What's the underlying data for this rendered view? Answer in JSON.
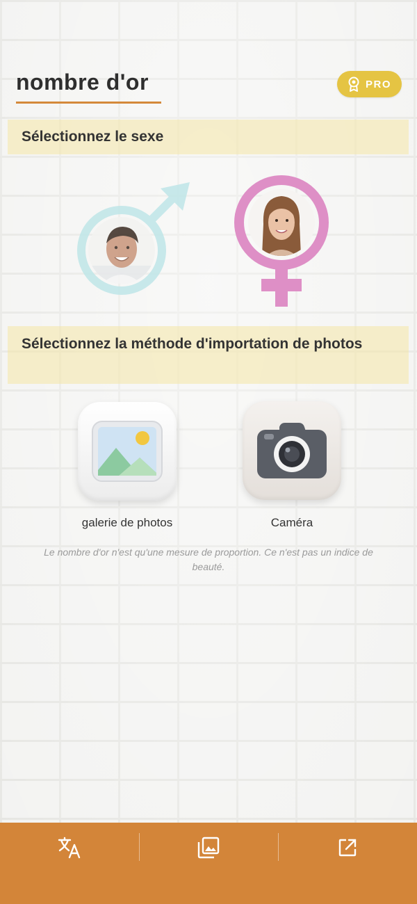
{
  "header": {
    "title": "nombre d'or",
    "pro_label": "PRO",
    "pro_icon": "award-icon"
  },
  "gender_section": {
    "heading": "Sélectionnez le sexe",
    "options": [
      {
        "name": "male",
        "icon": "male-symbol-icon",
        "color": "#bfe6e8"
      },
      {
        "name": "female",
        "icon": "female-symbol-icon",
        "color": "#de8fc6"
      }
    ]
  },
  "import_section": {
    "heading": "Sélectionnez la méthode d'importation de photos",
    "options": [
      {
        "label": "galerie de photos",
        "icon": "photo-gallery-icon"
      },
      {
        "label": "Caméra",
        "icon": "camera-icon"
      }
    ]
  },
  "disclaimer": "Le nombre d'or n'est qu'une mesure de proportion. Ce n'est pas un indice de beauté.",
  "bottom_bar": {
    "color": "#d38539",
    "items": [
      {
        "icon": "translate-icon"
      },
      {
        "icon": "image-gallery-icon"
      },
      {
        "icon": "open-external-icon"
      }
    ]
  },
  "colors": {
    "accent": "#d4893a",
    "pro_badge": "#e5c443",
    "section_bg": "#f4e5a5"
  }
}
